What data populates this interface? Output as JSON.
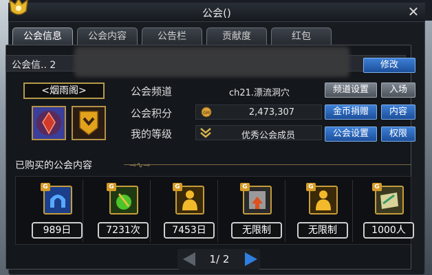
{
  "window": {
    "title": "公会()"
  },
  "tabs": [
    {
      "label": "公会信息",
      "active": true
    },
    {
      "label": "公会内容",
      "active": false
    },
    {
      "label": "公告栏",
      "active": false
    },
    {
      "label": "贡献度",
      "active": false
    },
    {
      "label": "红包",
      "active": false
    }
  ],
  "guild": {
    "name_label": "公会信.. 2",
    "edit_button": "修改",
    "display_name": "<烟雨阁>"
  },
  "info": {
    "channel_label": "公会频道",
    "channel_value": "ch21.漂流洞穴",
    "channel_settings_button": "频道设置",
    "enter_button": "入场",
    "points_label": "公会积分",
    "points_value": "2,473,307",
    "donate_button": "金币捐赠",
    "content_button": "内容",
    "rank_label": "我的等级",
    "rank_value": "优秀公会成员",
    "guild_settings_button": "公会设置",
    "permissions_button": "权限"
  },
  "purchased": {
    "title": "已购买的公会内容",
    "items": [
      {
        "label": "989日",
        "icon": "blue-arch-icon"
      },
      {
        "label": "7231次",
        "icon": "green-potion-icon"
      },
      {
        "label": "7453日",
        "icon": "gold-figure-icon"
      },
      {
        "label": "无限制",
        "icon": "arrow-scroll-icon"
      },
      {
        "label": "无限制",
        "icon": "gold-figure-icon"
      },
      {
        "label": "1000人",
        "icon": "scroll-icon"
      }
    ]
  },
  "pager": {
    "text": "1/ 2"
  },
  "colors": {
    "accent_blue": "#2f7fe0",
    "gold_border": "#c79d3c"
  }
}
